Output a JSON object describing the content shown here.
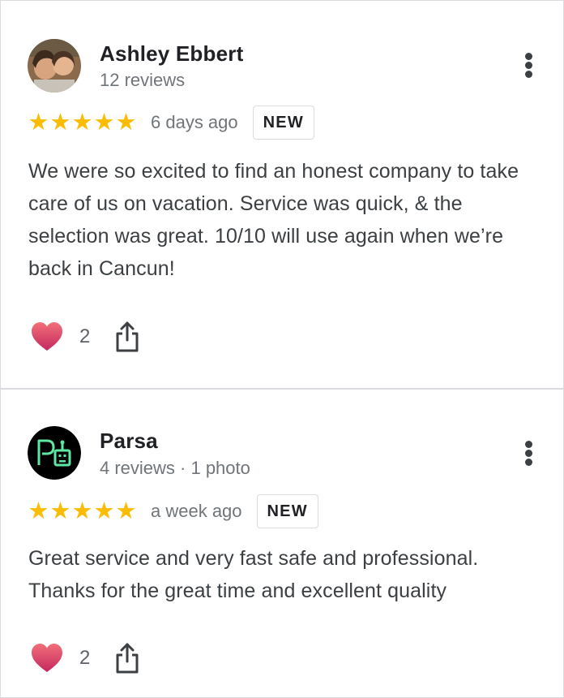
{
  "reviews": [
    {
      "name": "Ashley Ebbert",
      "meta": "12 reviews",
      "stars": 5,
      "date": "6 days ago",
      "badge": "NEW",
      "text": "We were so excited to find an honest company to take care of us on vacation. Service was quick, & the selection was great. 10/10 will use again when we’re back in Cancun!",
      "likes": "2"
    },
    {
      "name": "Parsa",
      "meta": "4 reviews · 1 photo",
      "stars": 5,
      "date": "a week ago",
      "badge": "NEW",
      "text": "Great service and very fast safe and professional. Thanks for the great time and excellent quality",
      "likes": "2"
    }
  ],
  "colors": {
    "star": "#fbbc04",
    "heart_top": "#f0616e",
    "heart_bottom": "#c92a5e",
    "divider": "#dadce0",
    "secondary_text": "#70757a"
  },
  "icons": {
    "menu": "more-vert-icon",
    "like": "heart-icon",
    "share": "share-icon",
    "star": "star-icon"
  }
}
